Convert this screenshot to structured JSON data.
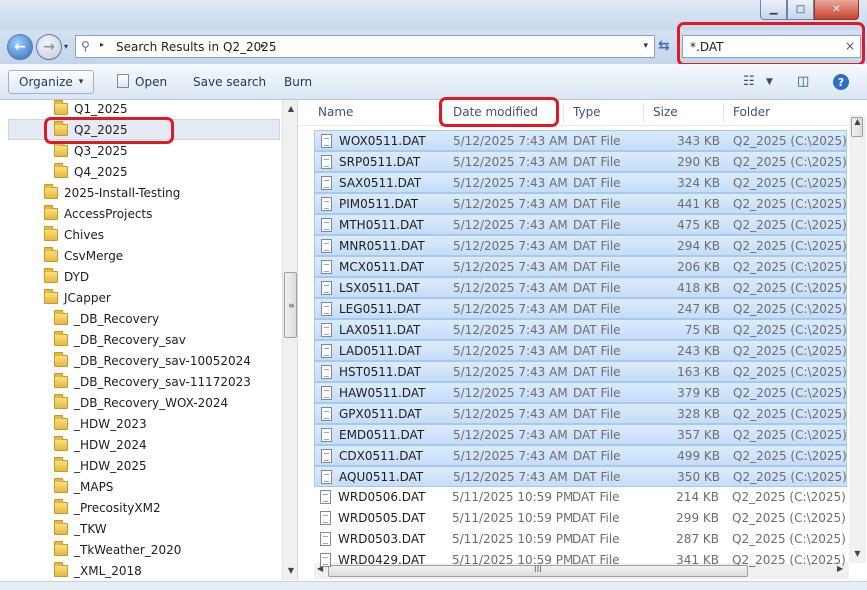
{
  "window": {
    "minimize_glyph": "▁",
    "maximize_glyph": "□",
    "close_glyph": "✕"
  },
  "address": {
    "path": "Search Results in Q2_2025",
    "sep": "▸",
    "drop": "▾"
  },
  "search": {
    "value": "*.DAT",
    "clear": "×"
  },
  "toolbar": {
    "organize": "Organize",
    "organize_arrow": "▾",
    "open": "Open",
    "save_search": "Save search",
    "burn": "Burn",
    "help": "?"
  },
  "nav_tree": [
    {
      "label": "Q1_2025",
      "indent": 1
    },
    {
      "label": "Q2_2025",
      "indent": 1,
      "selected": true
    },
    {
      "label": "Q3_2025",
      "indent": 1
    },
    {
      "label": "Q4_2025",
      "indent": 1
    },
    {
      "label": "2025-Install-Testing",
      "indent": 0
    },
    {
      "label": "AccessProjects",
      "indent": 0
    },
    {
      "label": "Chives",
      "indent": 0
    },
    {
      "label": "CsvMerge",
      "indent": 0
    },
    {
      "label": "DYD",
      "indent": 0
    },
    {
      "label": "JCapper",
      "indent": 0
    },
    {
      "label": "_DB_Recovery",
      "indent": 1
    },
    {
      "label": "_DB_Recovery_sav",
      "indent": 1
    },
    {
      "label": "_DB_Recovery_sav-10052024",
      "indent": 1
    },
    {
      "label": "_DB_Recovery_sav-11172023",
      "indent": 1
    },
    {
      "label": "_DB_Recovery_WOX-2024",
      "indent": 1
    },
    {
      "label": "_HDW_2023",
      "indent": 1
    },
    {
      "label": "_HDW_2024",
      "indent": 1
    },
    {
      "label": "_HDW_2025",
      "indent": 1
    },
    {
      "label": "_MAPS",
      "indent": 1
    },
    {
      "label": "_PrecosityXM2",
      "indent": 1
    },
    {
      "label": "_TKW",
      "indent": 1
    },
    {
      "label": "_TkWeather_2020",
      "indent": 1
    },
    {
      "label": "_XML_2018",
      "indent": 1
    }
  ],
  "columns": {
    "name": "Name",
    "date": "Date modified",
    "type": "Type",
    "size": "Size",
    "folder": "Folder"
  },
  "files": [
    {
      "name": "WOX0511.DAT",
      "date": "5/12/2025 7:43 AM",
      "type": "DAT File",
      "size": "343 KB",
      "folder": "Q2_2025 (C:\\2025)",
      "selected": true
    },
    {
      "name": "SRP0511.DAT",
      "date": "5/12/2025 7:43 AM",
      "type": "DAT File",
      "size": "290 KB",
      "folder": "Q2_2025 (C:\\2025)",
      "selected": true
    },
    {
      "name": "SAX0511.DAT",
      "date": "5/12/2025 7:43 AM",
      "type": "DAT File",
      "size": "324 KB",
      "folder": "Q2_2025 (C:\\2025)",
      "selected": true
    },
    {
      "name": "PIM0511.DAT",
      "date": "5/12/2025 7:43 AM",
      "type": "DAT File",
      "size": "441 KB",
      "folder": "Q2_2025 (C:\\2025)",
      "selected": true
    },
    {
      "name": "MTH0511.DAT",
      "date": "5/12/2025 7:43 AM",
      "type": "DAT File",
      "size": "475 KB",
      "folder": "Q2_2025 (C:\\2025)",
      "selected": true
    },
    {
      "name": "MNR0511.DAT",
      "date": "5/12/2025 7:43 AM",
      "type": "DAT File",
      "size": "294 KB",
      "folder": "Q2_2025 (C:\\2025)",
      "selected": true
    },
    {
      "name": "MCX0511.DAT",
      "date": "5/12/2025 7:43 AM",
      "type": "DAT File",
      "size": "206 KB",
      "folder": "Q2_2025 (C:\\2025)",
      "selected": true
    },
    {
      "name": "LSX0511.DAT",
      "date": "5/12/2025 7:43 AM",
      "type": "DAT File",
      "size": "418 KB",
      "folder": "Q2_2025 (C:\\2025)",
      "selected": true
    },
    {
      "name": "LEG0511.DAT",
      "date": "5/12/2025 7:43 AM",
      "type": "DAT File",
      "size": "247 KB",
      "folder": "Q2_2025 (C:\\2025)",
      "selected": true
    },
    {
      "name": "LAX0511.DAT",
      "date": "5/12/2025 7:43 AM",
      "type": "DAT File",
      "size": "75 KB",
      "folder": "Q2_2025 (C:\\2025)",
      "selected": true
    },
    {
      "name": "LAD0511.DAT",
      "date": "5/12/2025 7:43 AM",
      "type": "DAT File",
      "size": "243 KB",
      "folder": "Q2_2025 (C:\\2025)",
      "selected": true
    },
    {
      "name": "HST0511.DAT",
      "date": "5/12/2025 7:43 AM",
      "type": "DAT File",
      "size": "163 KB",
      "folder": "Q2_2025 (C:\\2025)",
      "selected": true
    },
    {
      "name": "HAW0511.DAT",
      "date": "5/12/2025 7:43 AM",
      "type": "DAT File",
      "size": "379 KB",
      "folder": "Q2_2025 (C:\\2025)",
      "selected": true
    },
    {
      "name": "GPX0511.DAT",
      "date": "5/12/2025 7:43 AM",
      "type": "DAT File",
      "size": "328 KB",
      "folder": "Q2_2025 (C:\\2025)",
      "selected": true
    },
    {
      "name": "EMD0511.DAT",
      "date": "5/12/2025 7:43 AM",
      "type": "DAT File",
      "size": "357 KB",
      "folder": "Q2_2025 (C:\\2025)",
      "selected": true
    },
    {
      "name": "CDX0511.DAT",
      "date": "5/12/2025 7:43 AM",
      "type": "DAT File",
      "size": "499 KB",
      "folder": "Q2_2025 (C:\\2025)",
      "selected": true
    },
    {
      "name": "AQU0511.DAT",
      "date": "5/12/2025 7:43 AM",
      "type": "DAT File",
      "size": "350 KB",
      "folder": "Q2_2025 (C:\\2025)",
      "selected": true
    },
    {
      "name": "WRD0506.DAT",
      "date": "5/11/2025 10:59 PM",
      "type": "DAT File",
      "size": "214 KB",
      "folder": "Q2_2025 (C:\\2025)",
      "selected": false
    },
    {
      "name": "WRD0505.DAT",
      "date": "5/11/2025 10:59 PM",
      "type": "DAT File",
      "size": "299 KB",
      "folder": "Q2_2025 (C:\\2025)",
      "selected": false
    },
    {
      "name": "WRD0503.DAT",
      "date": "5/11/2025 10:59 PM",
      "type": "DAT File",
      "size": "287 KB",
      "folder": "Q2_2025 (C:\\2025)",
      "selected": false
    },
    {
      "name": "WRD0429.DAT",
      "date": "5/11/2025 10:59 PM",
      "type": "DAT File",
      "size": "341 KB",
      "folder": "Q2_2025 (C:\\2025)",
      "selected": false
    }
  ],
  "scroll": {
    "up": "▲",
    "down": "▼",
    "left": "◀",
    "right": "▶",
    "grip_v": "≡",
    "grip_h": "III"
  },
  "colors": {
    "highlight_ring": "#e01a22",
    "selection": "#c4ddf8"
  }
}
